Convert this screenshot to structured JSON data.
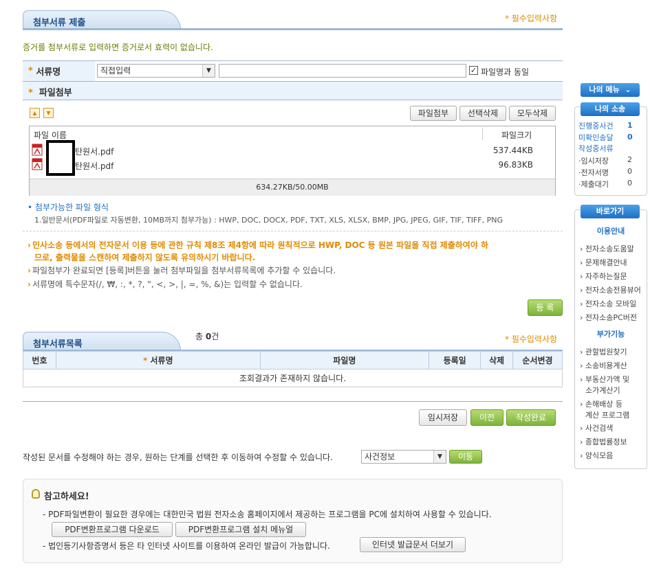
{
  "section1": {
    "title": "첨부서류 제출",
    "required_note": "* 필수입력사항",
    "notice": "증거를 첨부서류로 입력하면 증거로서 효력이 없습니다."
  },
  "doc_name_row": {
    "label": "서류명",
    "select_value": "직접입력",
    "text_value": "",
    "checkbox_label": "파일명과 동일",
    "checkbox_checked": true
  },
  "file_attach_row": {
    "label": "파일첨부"
  },
  "file_buttons": {
    "attach": "파일첨부",
    "delete_selected": "선택삭제",
    "delete_all": "모두삭제"
  },
  "file_list": {
    "col_name": "파일 이름",
    "col_size": "파일크기",
    "files": [
      {
        "name": "탄원서.pdf",
        "size": "537.44KB"
      },
      {
        "name": "탄원서.pdf",
        "size": "96.83KB"
      }
    ],
    "total": "634.27KB/50.00MB"
  },
  "formats": {
    "title": "첨부가능한 파일 형식",
    "text": "1.일반문서(PDF파일로 자동변환, 10MB까지 첨부가능) : HWP, DOC, DOCX, PDF, TXT, XLS, XLSX, BMP, JPG, JPEG, GIF, TIF, TIFF, PNG"
  },
  "notes": {
    "warn_line1": "민사소송 등에서의 전자문서 이용 등에 관한 규칙 제8조 제4항에 따라 원칙적으로 HWP, DOC 등 원본 파일을 직접 제출하여야 하",
    "warn_line2": "므로, 출력물을 스캔하여 제출하지 않도록 유의하시기 바랍니다.",
    "note1": "파일첨부가 완료되면 [등록]버튼을 눌러 첨부파일을 첨부서류목록에 추가할 수 있습니다.",
    "note2": "서류명에 특수문자(/, ₩, :, *, ?, \", <, >, |, =, %, &)는 입력할 수 없습니다."
  },
  "register_button": "등 록",
  "section2": {
    "title": "첨부서류목록",
    "count_prefix": "총",
    "count": "0",
    "count_suffix": "건",
    "required_note": "* 필수입력사항",
    "columns": [
      "번호",
      "서류명",
      "파일명",
      "등록일",
      "삭제",
      "순서변경"
    ],
    "empty_message": "조회결과가 존재하지 않습니다."
  },
  "actions": {
    "temp_save": "임시저장",
    "prev": "이전",
    "complete": "작성완료"
  },
  "move": {
    "text": "작성된 문서를 수정해야 하는 경우, 원하는 단계를 선택한 후 이동하여 수정할 수 있습니다.",
    "select_value": "사건정보",
    "button": "이동"
  },
  "reference": {
    "title": "참고하세요!",
    "line1": "- PDF파일변환이 필요한 경우에는 대한민국 법원 전자소송 홈페이지에서 제공하는 프로그램을 PC에 설치하여 사용할 수 있습니다.",
    "btn_download": "PDF변환프로그램 다운로드",
    "btn_manual": "PDF변환프로그램 설치 메뉴얼",
    "line2": "- 법인등기사항증명서 등은 타 인터넷 사이트를 이용하여 온라인 발급이 가능합니다.",
    "btn_more": "인터넷 발급문서 더보기"
  },
  "sidebar": {
    "my_menu": "나의 메뉴",
    "my_case": "나의 소송",
    "case_items": [
      {
        "label": "진행중사건",
        "count": "1"
      },
      {
        "label": "미확인송달",
        "count": "0"
      },
      {
        "label": "작성중서류",
        "count": ""
      }
    ],
    "sub_items": [
      {
        "label": "·임시저장",
        "count": "2"
      },
      {
        "label": "·전자서명",
        "count": "0"
      },
      {
        "label": "·제출대기",
        "count": "0"
      }
    ],
    "shortcut": "바로가기",
    "guide_title": "이용안내",
    "guide_items": [
      "전자소송도움말",
      "문제해결안내",
      "자주하는질문",
      "전자소송전용뷰어",
      "전자소송 모바일",
      "전자소송PC버전"
    ],
    "extra_title": "부가기능",
    "extra_items": [
      "관할법원찾기",
      "소송비용계산",
      "부동산가액 및",
      "소가계산기",
      "손해배상 등",
      "계산 프로그램",
      "사건검색",
      "종합법률정보",
      "양식모음"
    ]
  },
  "colors": {
    "accent_orange": "#e08a00",
    "header_blue": "#1f4f86",
    "green_button": "#7db33a"
  }
}
